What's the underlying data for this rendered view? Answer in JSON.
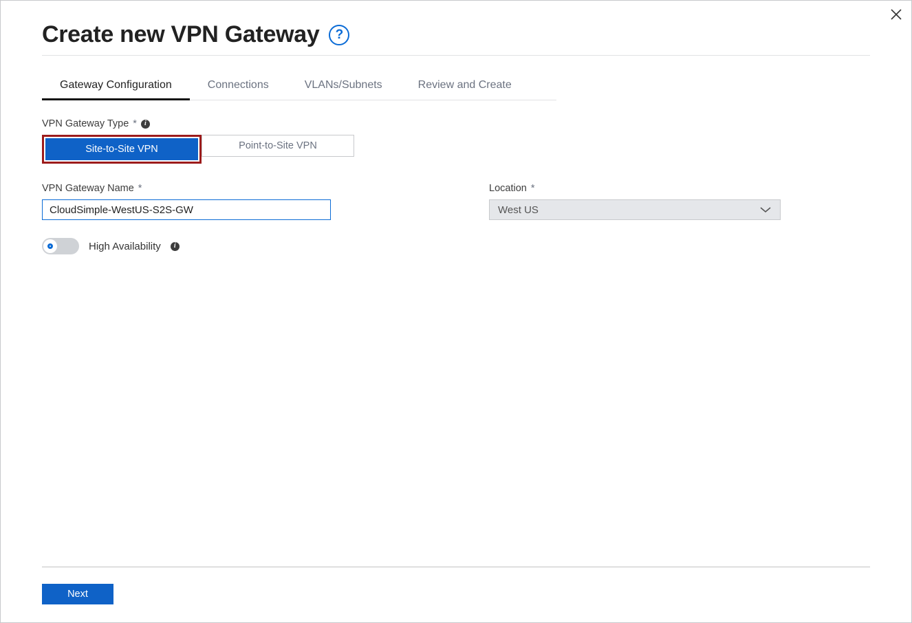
{
  "header": {
    "title": "Create new VPN Gateway",
    "help_tooltip": "?"
  },
  "tabs": [
    {
      "label": "Gateway Configuration",
      "active": true
    },
    {
      "label": "Connections",
      "active": false
    },
    {
      "label": "VLANs/Subnets",
      "active": false
    },
    {
      "label": "Review and Create",
      "active": false
    }
  ],
  "form": {
    "type_label": "VPN Gateway Type",
    "type_required": "*",
    "type_options": {
      "site_to_site": "Site-to-Site VPN",
      "point_to_site": "Point-to-Site VPN"
    },
    "type_selected": "site_to_site",
    "name_label": "VPN Gateway Name",
    "name_required": "*",
    "name_value": "CloudSimple-WestUS-S2S-GW",
    "location_label": "Location",
    "location_required": "*",
    "location_value": "West US",
    "ha_label": "High Availability",
    "ha_on": false
  },
  "footer": {
    "next_label": "Next"
  }
}
